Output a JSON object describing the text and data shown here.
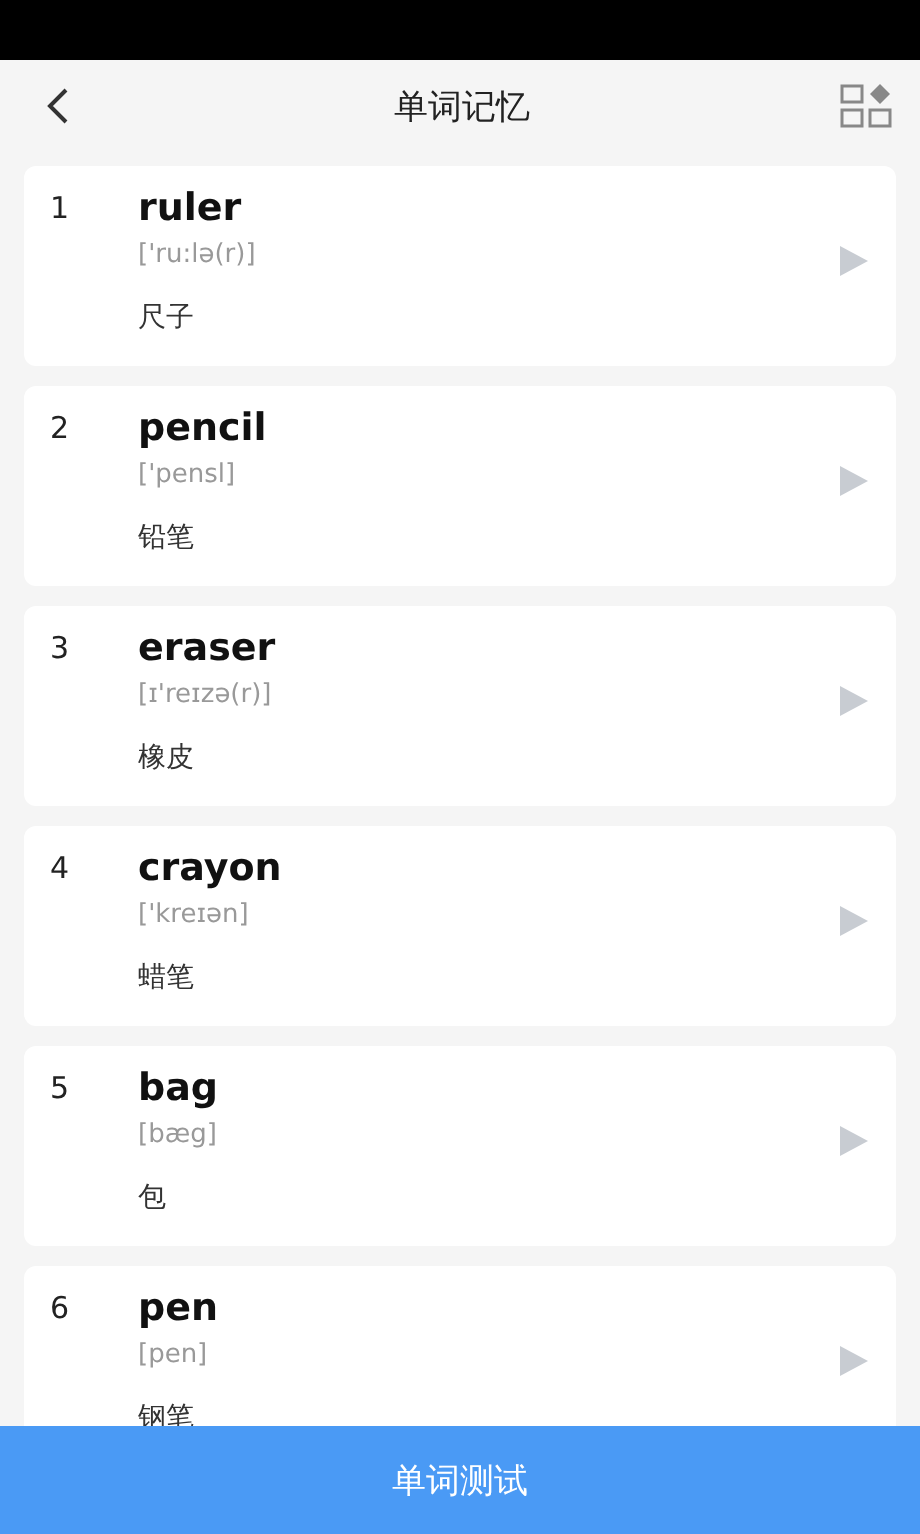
{
  "header": {
    "title": "单词记忆"
  },
  "words": [
    {
      "number": "1",
      "word": "ruler",
      "phonetic": "['ru:lə(r)]",
      "meaning": "尺子"
    },
    {
      "number": "2",
      "word": "pencil",
      "phonetic": "['pensl]",
      "meaning": "铅笔"
    },
    {
      "number": "3",
      "word": "eraser",
      "phonetic": "[ɪ'reɪzə(r)]",
      "meaning": "橡皮"
    },
    {
      "number": "4",
      "word": "crayon",
      "phonetic": "['kreɪən]",
      "meaning": "蜡笔"
    },
    {
      "number": "5",
      "word": "bag",
      "phonetic": "[bæg]",
      "meaning": "包"
    },
    {
      "number": "6",
      "word": "pen",
      "phonetic": "[pen]",
      "meaning": "钢笔"
    }
  ],
  "footer_button": "单词测试"
}
